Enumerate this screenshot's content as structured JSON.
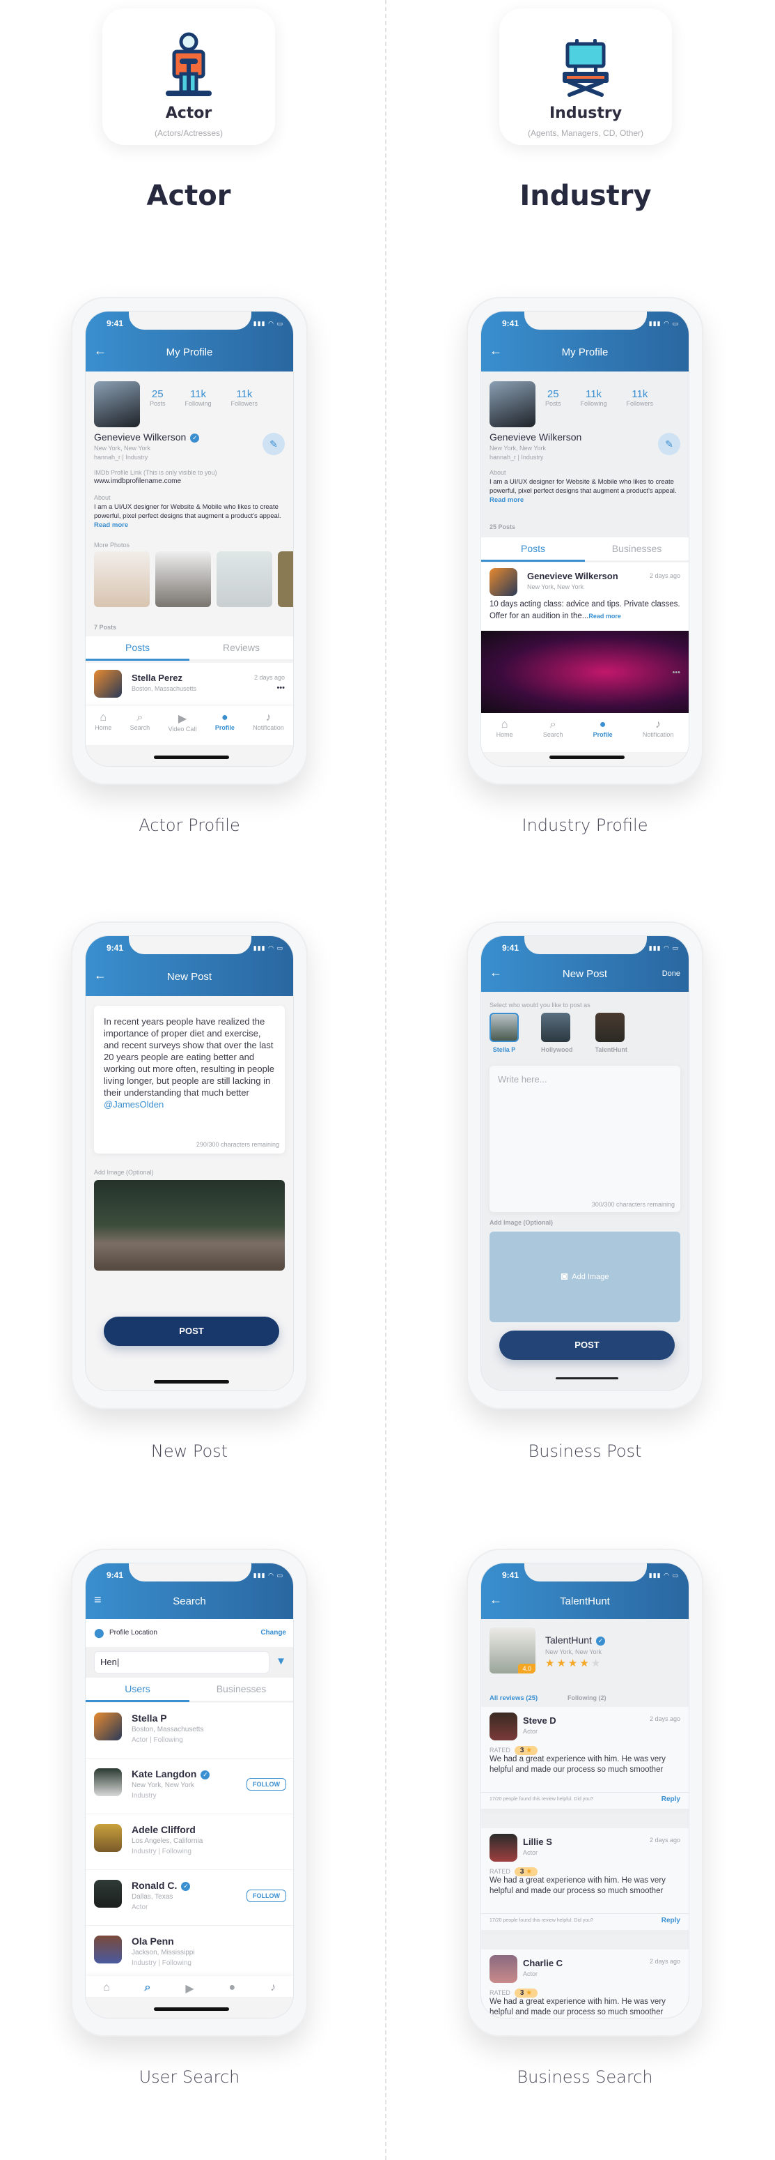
{
  "roles": [
    {
      "title": "Actor",
      "subtitle": "(Actors/Actresses)",
      "heading": "Actor",
      "icon": "actor-icon"
    },
    {
      "title": "Industry",
      "subtitle": "(Agents, Managers, CD, Other)",
      "heading": "Industry",
      "icon": "director-chair-icon"
    }
  ],
  "status": {
    "time": "9:41",
    "signal": "signal-wifi-battery"
  },
  "actor_profile": {
    "caption": "Actor Profile",
    "header_title": "My Profile",
    "stats": [
      {
        "value": "25",
        "label": "Posts"
      },
      {
        "value": "11k",
        "label": "Following"
      },
      {
        "value": "11k",
        "label": "Followers"
      }
    ],
    "name": "Genevieve Wilkerson",
    "location": "New York, New York",
    "handle": "hannah_r | Industry",
    "imdb_label": "IMDb Profile Link (This is only visible to you)",
    "imdb_url": "www.imdbprofilename.come",
    "about_label": "About",
    "about_text": "I am a UI/UX designer for Website & Mobile who likes to create powerful, pixel perfect designs that augment a product's appeal.",
    "read_more": "Read more",
    "more_photos_label": "More Photos",
    "posts_count": "7 Posts",
    "tabs": [
      "Posts",
      "Reviews"
    ],
    "post": {
      "name": "Stella Perez",
      "location": "Boston, Massachusetts",
      "time": "2 days ago",
      "more": "•••"
    },
    "nav": [
      "Home",
      "Search",
      "Video Call",
      "Profile",
      "Notification"
    ]
  },
  "industry_profile": {
    "caption": "Industry Profile",
    "header_title": "My Profile",
    "stats": [
      {
        "value": "25",
        "label": "Posts"
      },
      {
        "value": "11k",
        "label": "Following"
      },
      {
        "value": "11k",
        "label": "Followers"
      }
    ],
    "name": "Genevieve Wilkerson",
    "location": "New York, New York",
    "handle": "hannah_r | Industry",
    "about_label": "About",
    "about_text": "I am a UI/UX designer for Website & Mobile who likes to create powerful, pixel perfect designs that augment a product's appeal.",
    "read_more": "Read more",
    "posts_count": "25 Posts",
    "tabs": [
      "Posts",
      "Businesses"
    ],
    "post": {
      "name": "Genevieve Wilkerson",
      "location": "New York, New York",
      "time": "2 days ago",
      "text": "10 days acting class: advice and tips. Private classes. Offer for an audition in the...",
      "read_more": "Read more",
      "more": "•••"
    },
    "nav": [
      "Home",
      "Search",
      "Profile",
      "Notification"
    ]
  },
  "new_post": {
    "caption": "New Post",
    "header_title": "New Post",
    "text": "In recent years people have realized the importance of proper diet and exercise, and recent surveys show that over the last 20 years people are eating better and working out more often, resulting in people living longer, but people are still lacking in their understanding that much better",
    "mention": "@JamesOlden",
    "counter": "290/300 characters remaining",
    "add_image_label": "Add Image (Optional)",
    "post_button": "POST"
  },
  "business_post": {
    "caption": "Business Post",
    "header_title": "New Post",
    "done": "Done",
    "select_label": "Select who would you like to post as",
    "accounts": [
      {
        "name": "Stella P",
        "selected": true
      },
      {
        "name": "Hollywood",
        "selected": false
      },
      {
        "name": "TalentHunt",
        "selected": false
      }
    ],
    "placeholder": "Write here...",
    "counter": "300/300 characters remaining",
    "add_image_label": "Add Image (Optional)",
    "add_image_button": "Add Image",
    "post_button": "POST"
  },
  "user_search": {
    "caption": "User Search",
    "header_title": "Search",
    "location_label": "Profile Location",
    "change": "Change",
    "query": "Hen|",
    "tabs": [
      "Users",
      "Businesses"
    ],
    "users": [
      {
        "name": "Stella P",
        "location": "Boston, Massachusetts",
        "meta": "Actor | Following",
        "verified": false,
        "follow": ""
      },
      {
        "name": "Kate Langdon",
        "location": "New York, New York",
        "meta": "Industry",
        "verified": true,
        "follow": "FOLLOW"
      },
      {
        "name": "Adele Clifford",
        "location": "Los Angeles, California",
        "meta": "Industry | Following",
        "verified": false,
        "follow": ""
      },
      {
        "name": "Ronald C.",
        "location": "Dallas, Texas",
        "meta": "Actor",
        "verified": true,
        "follow": "FOLLOW"
      },
      {
        "name": "Ola Penn",
        "location": "Jackson, Mississippi",
        "meta": "Industry | Following",
        "verified": false,
        "follow": ""
      }
    ]
  },
  "business_search": {
    "caption": "Business Search",
    "header_title": "TalentHunt",
    "business": {
      "name": "TalentHunt",
      "location": "New York, New York",
      "rating": "4.0",
      "stars": 4,
      "max_stars": 5
    },
    "tabs": [
      "All reviews (25)",
      "Following (2)"
    ],
    "rated_label": "RATED",
    "reviews": [
      {
        "name": "Steve D",
        "role": "Actor",
        "time": "2 days ago",
        "rating": "3",
        "text": "We had a great experience with him. He was very helpful and made our process so much smoother",
        "helpful": "17/20 people found this review helpful. Did you?",
        "reply": "Reply"
      },
      {
        "name": "Lillie S",
        "role": "Actor",
        "time": "2 days ago",
        "rating": "3",
        "text": "We had a great experience with him. He was very helpful and made our process so much smoother",
        "helpful": "17/20 people found this review helpful. Did you?",
        "reply": "Reply"
      },
      {
        "name": "Charlie C",
        "role": "Actor",
        "time": "2 days ago",
        "rating": "3",
        "text": "We had a great experience with him. He was very helpful and made our process so much smoother",
        "helpful": "",
        "reply": ""
      }
    ]
  },
  "colors": {
    "primary": "#3a8fd1",
    "header_dark": "#2a67a0",
    "button": "#18386c",
    "star": "#f5a623",
    "accent_orange": "#f26b3a",
    "accent_cyan": "#4fd0e0"
  }
}
